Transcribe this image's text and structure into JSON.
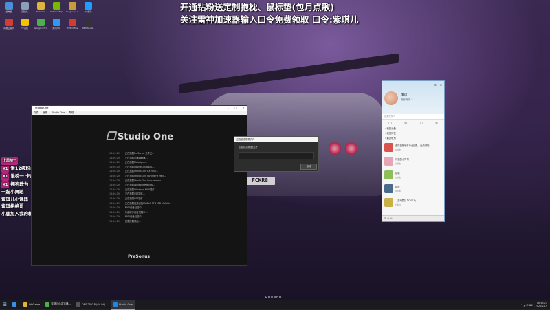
{
  "banner": {
    "line1": "开通钻粉送定制抱枕、鼠标垫(包月点歌)",
    "line2": "关注雷神加速器输入口令免费领取 口令:紫琪儿"
  },
  "wallpaper": {
    "plate_text": "FCKR8",
    "brand_mark": "CROWNED"
  },
  "chat_overlay": [
    {
      "tag": "上周榜一",
      "text": ""
    },
    {
      "tag": "X1",
      "text": "谁12级粉丝赠送vx群"
    },
    {
      "tag": "X1",
      "text": "谁榜一 卡皮管"
    },
    {
      "tag": "X1",
      "text": "拥抱欧为 • ᴗ •"
    },
    {
      "tag": "",
      "text": "一起小舞蹈"
    },
    {
      "tag": "",
      "text": "紫琪儿小谁器"
    },
    {
      "tag": "",
      "text": "紫琪格格哥"
    },
    {
      "tag": "",
      "text": "小鹿加入我的粉丝团吧 ❤"
    }
  ],
  "studio_one": {
    "title": "Studio One",
    "menu": [
      "文件",
      "编辑",
      "Studio One",
      "帮助"
    ],
    "logo_text": "Studio One",
    "presonus": "PreSonus",
    "log": [
      {
        "time": "16:56:29",
        "msg": "正在加载PreSonus 文件夹..."
      },
      {
        "time": "16:56:29",
        "msg": "正在加载乐器编辑器..."
      },
      {
        "time": "16:56:29",
        "msg": "正在加载Melodyne..."
      },
      {
        "time": "16:56:29",
        "msg": "正在加载SoundCloud插件..."
      },
      {
        "time": "16:56:29",
        "msg": "正在加载Studio One FX Pack..."
      },
      {
        "time": "16:56:29",
        "msg": "正在加载Studio One Hybrid FX Pack..."
      },
      {
        "time": "16:56:29",
        "msg": "正在加载Studio One Instruments..."
      },
      {
        "time": "16:56:29",
        "msg": "正在加载Windows音频插件..."
      },
      {
        "time": "16:56:29",
        "msg": "正在加载Windows MIDI插件..."
      },
      {
        "time": "16:56:29",
        "msg": "正在加载VST插件..."
      },
      {
        "time": "16:56:29",
        "msg": "正在扫描VST插件..."
      },
      {
        "time": "16:56:29",
        "msg": "正在加载音频设备NVIDIA PTD LTD M-AUA..."
      },
      {
        "time": "16:56:29",
        "msg": "MIDI设备扫描中..."
      },
      {
        "time": "16:56:29",
        "msg": "外部硬件设备扫描中..."
      },
      {
        "time": "16:56:29",
        "msg": "MIDI设备扫描中..."
      },
      {
        "time": "16:56:29",
        "msg": "加载控制界面..."
      }
    ]
  },
  "dialog": {
    "title": "正在检查配置文件",
    "message": "正在检查配置文件...",
    "button": "取消"
  },
  "qq": {
    "nickname": "紫琪",
    "signature": "快乐每天 ♡",
    "search_placeholder": "搜索联系人",
    "groups": [
      "我的设备",
      "我的好友",
      "最近联系"
    ],
    "contacts": [
      {
        "name": "虚拟直播软件专业团队 - 免费领取",
        "status": "[在线]",
        "color": "#d9534f"
      },
      {
        "name": "冷漠的小哥哥",
        "status": "[离线]",
        "color": "#e7a4b4"
      },
      {
        "name": "蛤蟆",
        "status": "[在线]",
        "color": "#8fbf5a"
      },
      {
        "name": "猫咪",
        "status": "[在线]",
        "color": "#4a6b8a"
      },
      {
        "name": "【游戏群】「Y2021」...",
        "status": "[消息]",
        "color": "#c7b24a"
      }
    ],
    "footer": "☰ ⚙ ✉"
  },
  "taskbar": {
    "items": [
      {
        "label": "",
        "color": "#3a8ee6"
      },
      {
        "label": "WeGame",
        "color": "#e0b33a"
      },
      {
        "label": "紫琪儿小浏览器...",
        "color": "#4caf50"
      },
      {
        "label": "OBS 25.0.8 (64-bit)...",
        "color": "#555555"
      },
      {
        "label": "Studio One",
        "color": "#1e88e5",
        "active": true
      }
    ],
    "tray": "^ ◢ 中 ⌨",
    "time": "16:56:21",
    "date": "2021/2/19"
  },
  "desktop_icons": [
    {
      "label": "此电脑",
      "color": "#4a90d9"
    },
    {
      "label": "回收站",
      "color": "#8aa0b8"
    },
    {
      "label": "WeGame",
      "color": "#e0b33a"
    },
    {
      "label": "Geforce Experience",
      "color": "#76b900"
    },
    {
      "label": "League of Legends",
      "color": "#c89b3c"
    },
    {
      "label": "QQ游戏",
      "color": "#1e9fff"
    },
    {
      "label": "网易云音乐",
      "color": "#d43c33"
    },
    {
      "label": "YY语音",
      "color": "#f5c400"
    },
    {
      "label": "Google Chrome",
      "color": "#4caf50"
    },
    {
      "label": "腾讯QQ",
      "color": "#2b9bf4"
    },
    {
      "label": "WPS Office",
      "color": "#d13c2e"
    },
    {
      "label": "OBS Studio",
      "color": "#333333"
    }
  ]
}
